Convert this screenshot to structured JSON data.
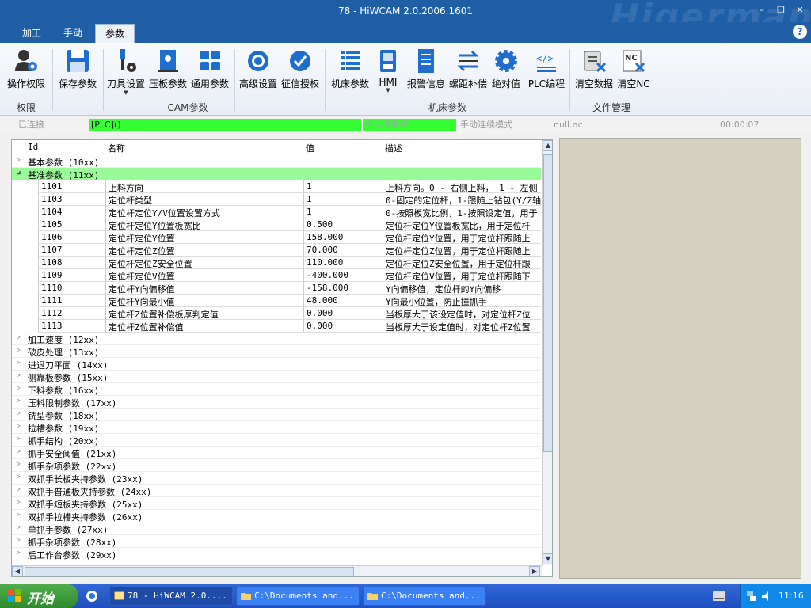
{
  "window": {
    "title": "78 - HiWCAM 2.0.2006.1601",
    "watermark": "Higerman",
    "minimize": "–",
    "restore": "❐",
    "close": "✕"
  },
  "menu_tabs": [
    {
      "label": "加工"
    },
    {
      "label": "手动"
    },
    {
      "label": "参数",
      "active": true
    }
  ],
  "help_label": "?",
  "ribbon": {
    "groups": [
      {
        "label": "权限"
      },
      {
        "label": "CAM参数"
      },
      {
        "label": "机床参数"
      },
      {
        "label": "文件管理"
      }
    ],
    "buttons": [
      {
        "label": "操作权限",
        "icon": "user-gear-icon"
      },
      {
        "label": "保存参数",
        "icon": "save-icon"
      },
      {
        "label": "刀具设置",
        "icon": "tool-icon",
        "dropdown": "▼"
      },
      {
        "label": "压板参数",
        "icon": "clamp-icon"
      },
      {
        "label": "通用参数",
        "icon": "grid-icon"
      },
      {
        "label": "高级设置",
        "icon": "advanced-settings-icon"
      },
      {
        "label": "征信授权",
        "icon": "authorization-icon"
      },
      {
        "label": "机床参数",
        "icon": "list-icon"
      },
      {
        "label": "HMI",
        "icon": "hmi-icon",
        "dropdown": "▼"
      },
      {
        "label": "报警信息",
        "icon": "alarm-doc-icon"
      },
      {
        "label": "螺距补偿",
        "icon": "pitch-comp-icon"
      },
      {
        "label": "绝对值",
        "icon": "gear-icon"
      },
      {
        "label": "PLC编程",
        "icon": "code-icon"
      },
      {
        "label": "清空数据",
        "icon": "clear-data-icon"
      },
      {
        "label": "清空NC",
        "icon": "clear-nc-icon"
      }
    ]
  },
  "status": {
    "connection": "已连接",
    "plc": "[PLC]()",
    "machine_state": "机床准备好",
    "mode": "手动连续模式",
    "file": "null.nc",
    "timer": "00:00:07",
    "highlight_color": "#33ff33"
  },
  "grid": {
    "columns": {
      "id": "Id",
      "name": "名称",
      "value": "值",
      "desc": "描述"
    },
    "groups_before": [
      {
        "label": "基本参数 (10xx)",
        "expanded": false
      }
    ],
    "expanded_group": {
      "label": "基准参数 (11xx)",
      "highlight_color": "#98fb98"
    },
    "rows": [
      {
        "id": "1101",
        "name": "上料方向",
        "value": "1",
        "desc": "上料方向。0 - 右侧上料， 1 - 左侧"
      },
      {
        "id": "1103",
        "name": "定位杆类型",
        "value": "1",
        "desc": "0-固定的定位杆，1-跟随上钻包(Y/Z轴"
      },
      {
        "id": "1104",
        "name": "定位杆定位Y/V位置设置方式",
        "value": "1",
        "desc": "0-按照板宽比例，1-按照设定值，用于"
      },
      {
        "id": "1105",
        "name": "定位杆定位Y位置板宽比",
        "value": "0.500",
        "desc": "定位杆定位Y位置板宽比，用于定位杆"
      },
      {
        "id": "1106",
        "name": "定位杆定位Y位置",
        "value": "158.000",
        "desc": "定位杆定位Y位置，用于定位杆跟随上"
      },
      {
        "id": "1107",
        "name": "定位杆定位Z位置",
        "value": "70.000",
        "desc": "定位杆定位Z位置，用于定位杆跟随上"
      },
      {
        "id": "1108",
        "name": "定位杆定位Z安全位置",
        "value": "110.000",
        "desc": "定位杆定位Z安全位置，用于定位杆跟"
      },
      {
        "id": "1109",
        "name": "定位杆定位V位置",
        "value": "-400.000",
        "desc": "定位杆定位V位置，用于定位杆跟随下"
      },
      {
        "id": "1110",
        "name": "定位杆Y向偏移值",
        "value": "-158.000",
        "desc": "Y向偏移值，定位杆的Y向偏移"
      },
      {
        "id": "1111",
        "name": "定位杆Y向最小值",
        "value": "48.000",
        "desc": "Y向最小位置，防止撞抓手"
      },
      {
        "id": "1112",
        "name": "定位杆Z位置补偿板厚判定值",
        "value": "0.000",
        "desc": "当板厚大于该设定值时，对定位杆Z位"
      },
      {
        "id": "1113",
        "name": "定位杆Z位置补偿值",
        "value": "0.000",
        "desc": "当板厚大于设定值时，对定位杆Z位置"
      }
    ],
    "groups_after": [
      {
        "label": "加工速度 (12xx)"
      },
      {
        "label": "破皮处理 (13xx)"
      },
      {
        "label": "进退刀平面 (14xx)"
      },
      {
        "label": "侧靠板参数 (15xx)"
      },
      {
        "label": "下料参数 (16xx)"
      },
      {
        "label": "压料限制参数 (17xx)"
      },
      {
        "label": "铣型参数 (18xx)"
      },
      {
        "label": "拉槽参数 (19xx)"
      },
      {
        "label": "抓手结构 (20xx)"
      },
      {
        "label": "抓手安全阈值 (21xx)"
      },
      {
        "label": "抓手杂项参数 (22xx)"
      },
      {
        "label": "双抓手长板夹持参数 (23xx)"
      },
      {
        "label": "双抓手普通板夹持参数 (24xx)"
      },
      {
        "label": "双抓手短板夹持参数 (25xx)"
      },
      {
        "label": "双抓手拉槽夹持参数 (26xx)"
      },
      {
        "label": "单抓手参数 (27xx)"
      },
      {
        "label": "抓手杂项参数 (28xx)"
      },
      {
        "label": "后工作台参数 (29xx)"
      }
    ]
  },
  "taskbar": {
    "start_label": "开始",
    "items": [
      {
        "label": "78 - HiWCAM 2.0....",
        "active": true
      },
      {
        "label": "C:\\Documents and..."
      },
      {
        "label": "C:\\Documents and..."
      }
    ],
    "clock": "11:16"
  }
}
